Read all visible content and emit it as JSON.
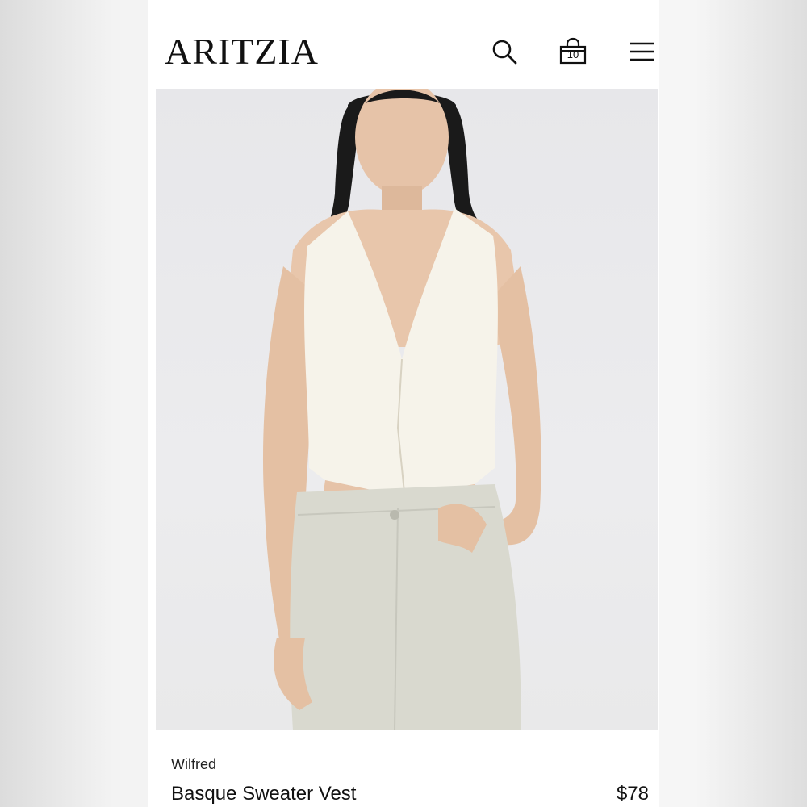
{
  "header": {
    "logo": "ARITZIA",
    "bag_count": "10",
    "icons": [
      "search-icon",
      "shopping-bag-icon",
      "menu-icon"
    ]
  },
  "product": {
    "brand": "Wilfred",
    "name": "Basque Sweater Vest",
    "price": "$78"
  },
  "colors": {
    "background": "#ffffff",
    "text": "#111111",
    "photo_backdrop": "#e9e9eb",
    "vest": "#f6f3ea",
    "jeans": "#d9d9cf"
  }
}
